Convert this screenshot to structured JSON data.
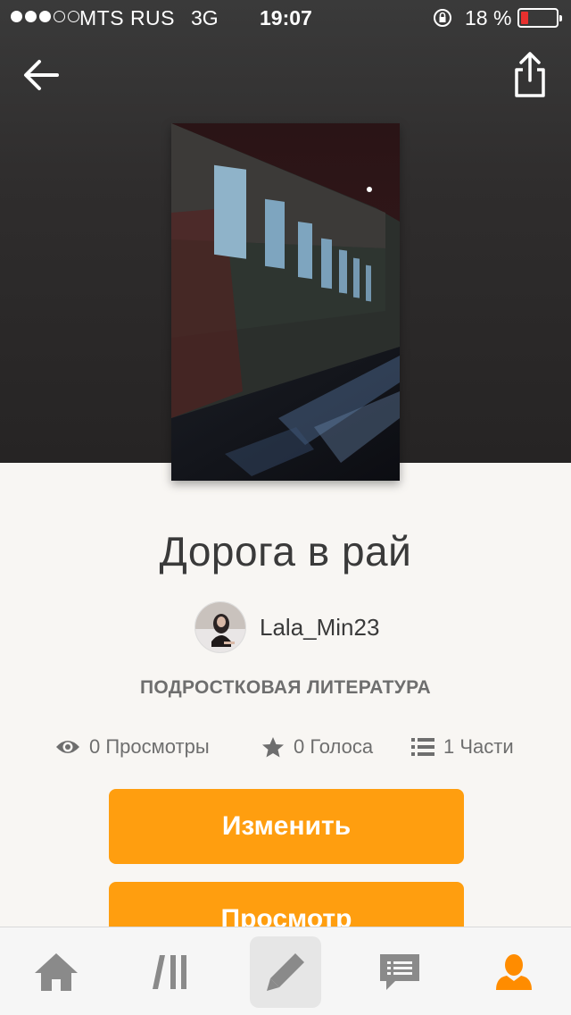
{
  "status_bar": {
    "carrier": "MTS RUS",
    "network": "3G",
    "time": "19:07",
    "battery_percent": "18 %",
    "battery_level": 0.18,
    "signal_bars_filled": 3,
    "signal_bars_total": 5
  },
  "header": {
    "back_icon": "arrow-left-icon",
    "share_icon": "share-icon"
  },
  "story": {
    "title": "Дорога в рай",
    "author": "Lala_Min23",
    "genre": "ПОДРОСТКОВАЯ ЛИТЕРАТУРА"
  },
  "stats": {
    "views": "0 Просмотры",
    "votes": "0 Голоса",
    "parts": "1 Части"
  },
  "actions": {
    "edit_label": "Изменить",
    "preview_label": "Просмотр"
  },
  "tab_bar": {
    "tabs": [
      {
        "name": "home",
        "icon": "home-icon"
      },
      {
        "name": "library",
        "icon": "library-icon"
      },
      {
        "name": "write",
        "icon": "pencil-icon",
        "selected": true
      },
      {
        "name": "messages",
        "icon": "chat-icon"
      },
      {
        "name": "profile",
        "icon": "profile-icon",
        "active": true
      }
    ]
  },
  "colors": {
    "accent": "#ff9e0f",
    "hero_bg": "#2f2d2d",
    "page_bg": "#f8f6f3",
    "text_dark": "#3a3a3a",
    "text_muted": "#6e6e6e",
    "tab_icon": "#8a8a8a",
    "tab_active": "#ff8c00"
  }
}
